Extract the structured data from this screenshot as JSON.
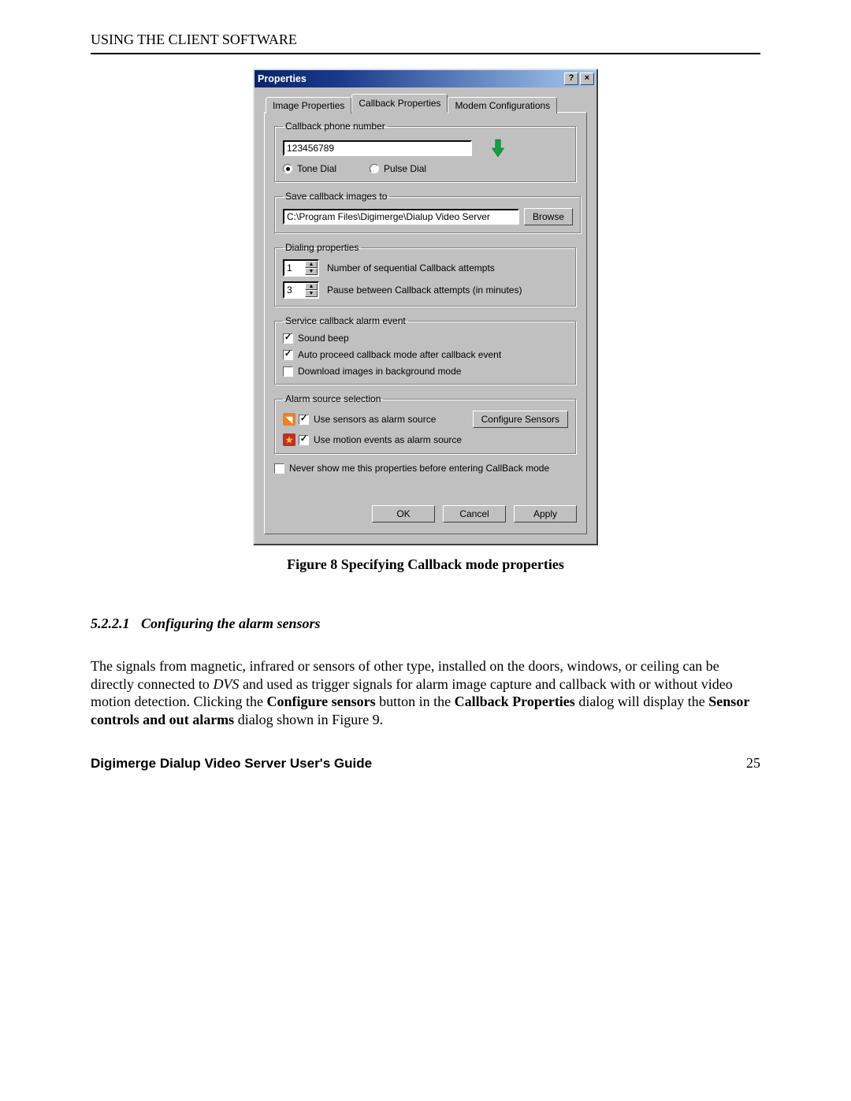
{
  "page_header": "USING THE CLIENT SOFTWARE",
  "dialog": {
    "title": "Properties",
    "help_btn": "?",
    "close_btn": "×",
    "tabs": [
      "Image Properties",
      "Callback Properties",
      "Modem Configurations"
    ],
    "callback_phone": {
      "legend": "Callback phone number",
      "value": "123456789",
      "tone_label": "Tone Dial",
      "pulse_label": "Pulse Dial"
    },
    "save_to": {
      "legend": "Save callback images to",
      "path": "C:\\Program Files\\Digimerge\\Dialup Video Server",
      "browse": "Browse"
    },
    "dialing": {
      "legend": "Dialing properties",
      "attempts_value": "1",
      "attempts_label": "Number of sequential Callback attempts",
      "pause_value": "3",
      "pause_label": "Pause between Callback attempts (in minutes)"
    },
    "service": {
      "legend": "Service callback alarm event",
      "sound_beep": "Sound beep",
      "auto_proceed": "Auto proceed callback mode after callback event",
      "download_bg": "Download images in background mode"
    },
    "alarm": {
      "legend": "Alarm source selection",
      "use_sensors": "Use sensors as alarm source",
      "configure_btn": "Configure Sensors",
      "use_motion": "Use motion events as alarm source"
    },
    "never_show": "Never show me this properties before entering CallBack mode",
    "buttons": {
      "ok": "OK",
      "cancel": "Cancel",
      "apply": "Apply"
    }
  },
  "figure_caption": "Figure 8 Specifying Callback mode properties",
  "subsection": {
    "num": "5.2.2.1",
    "title": "Configuring the alarm sensors"
  },
  "paragraph": {
    "p1": "The signals from magnetic, infrared or sensors of other type, installed on the doors, windows, or ceiling can be directly connected to ",
    "dvs": "DVS",
    "p2": " and used as trigger signals for alarm image capture and callback with or without video motion detection. Clicking the ",
    "b1": "Configure sensors",
    "p3": " button in the ",
    "b2": "Callback Properties",
    "p4": " dialog will display the ",
    "b3": "Sensor controls and out alarms",
    "p5": " dialog shown in Figure 9."
  },
  "footer": {
    "doc_title": "Digimerge Dialup Video Server User's Guide",
    "page_num": "25"
  }
}
